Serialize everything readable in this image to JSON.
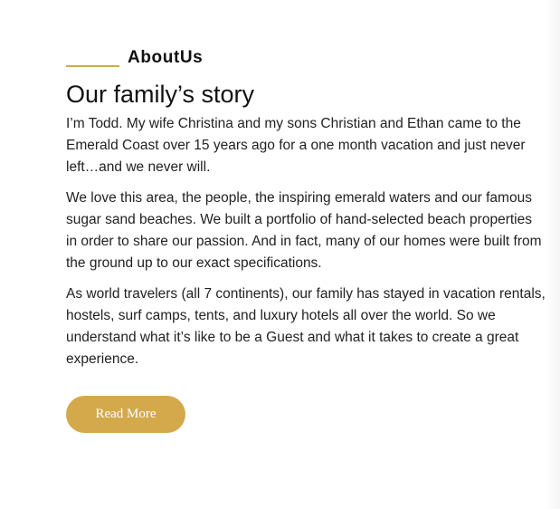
{
  "about": {
    "eyebrow": "AboutUs",
    "title": "Our family’s story",
    "paragraphs": [
      "I’m Todd. My wife Christina and my sons Christian and Ethan came to the Emerald Coast over 15 years ago for a one month vacation and just never left…and we never will.",
      "We love this area, the people, the inspiring emerald waters and our famous sugar sand beaches. We built a portfolio of hand-selected beach properties in order to share our passion. And in fact, many of our homes were built from the ground up to our exact specifications.",
      "As world travelers (all 7 continents), our family has stayed in vacation rentals, hostels, surf camps, tents, and luxury hotels all over the world. So we understand what it’s like to be a Guest and what it takes to create a great experience."
    ],
    "button_label": "Read More"
  },
  "colors": {
    "accent": "#d4a94c",
    "heading": "#111111",
    "body_text": "#222222",
    "background": "#ffffff"
  }
}
